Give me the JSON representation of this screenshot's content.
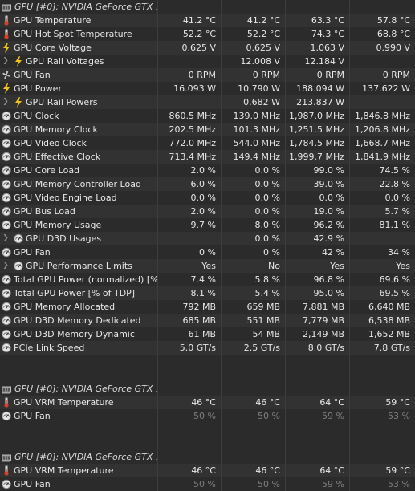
{
  "sections": [
    {
      "title": "GPU [#0]: NVIDIA GeForce GTX 1...",
      "rows": [
        {
          "icon": "thermometer-icon",
          "label": "GPU Temperature",
          "values": [
            "41.2 °C",
            "41.2 °C",
            "63.3 °C",
            "57.8 °C"
          ]
        },
        {
          "icon": "thermometer-icon",
          "label": "GPU Hot Spot Temperature",
          "values": [
            "52.2 °C",
            "52.2 °C",
            "74.3 °C",
            "68.8 °C"
          ]
        },
        {
          "icon": "lightning-icon",
          "label": "GPU Core Voltage",
          "values": [
            "0.625 V",
            "0.625 V",
            "1.063 V",
            "0.990 V"
          ]
        },
        {
          "icon": "lightning-icon",
          "label": "GPU Rail Voltages",
          "indent": true,
          "expander": true,
          "values": [
            "",
            "12.008 V",
            "12.184 V",
            ""
          ]
        },
        {
          "icon": "fan-icon",
          "label": "GPU Fan",
          "values": [
            "0 RPM",
            "0 RPM",
            "0 RPM",
            "0 RPM"
          ]
        },
        {
          "icon": "lightning-icon",
          "label": "GPU Power",
          "values": [
            "16.093 W",
            "10.790 W",
            "188.094 W",
            "137.622 W"
          ]
        },
        {
          "icon": "lightning-icon",
          "label": "GPU Rail Powers",
          "indent": true,
          "expander": true,
          "values": [
            "",
            "0.682 W",
            "213.837 W",
            ""
          ]
        },
        {
          "icon": "gauge-icon",
          "label": "GPU Clock",
          "values": [
            "860.5 MHz",
            "139.0 MHz",
            "1,987.0 MHz",
            "1,846.8 MHz"
          ]
        },
        {
          "icon": "gauge-icon",
          "label": "GPU Memory Clock",
          "values": [
            "202.5 MHz",
            "101.3 MHz",
            "1,251.5 MHz",
            "1,206.8 MHz"
          ]
        },
        {
          "icon": "gauge-icon",
          "label": "GPU Video Clock",
          "values": [
            "772.0 MHz",
            "544.0 MHz",
            "1,784.5 MHz",
            "1,668.7 MHz"
          ]
        },
        {
          "icon": "gauge-icon",
          "label": "GPU Effective Clock",
          "values": [
            "713.4 MHz",
            "149.4 MHz",
            "1,999.7 MHz",
            "1,841.9 MHz"
          ]
        },
        {
          "icon": "gauge-icon",
          "label": "GPU Core Load",
          "values": [
            "2.0 %",
            "0.0 %",
            "99.0 %",
            "74.5 %"
          ]
        },
        {
          "icon": "gauge-icon",
          "label": "GPU Memory Controller Load",
          "values": [
            "6.0 %",
            "0.0 %",
            "39.0 %",
            "22.8 %"
          ]
        },
        {
          "icon": "gauge-icon",
          "label": "GPU Video Engine Load",
          "values": [
            "0.0 %",
            "0.0 %",
            "0.0 %",
            "0.0 %"
          ]
        },
        {
          "icon": "gauge-icon",
          "label": "GPU Bus Load",
          "values": [
            "2.0 %",
            "0.0 %",
            "19.0 %",
            "5.7 %"
          ]
        },
        {
          "icon": "gauge-icon",
          "label": "GPU Memory Usage",
          "values": [
            "9.7 %",
            "8.0 %",
            "96.2 %",
            "81.1 %"
          ]
        },
        {
          "icon": "gauge-icon",
          "label": "GPU D3D Usages",
          "indent": true,
          "expander": true,
          "values": [
            "",
            "0.0 %",
            "42.9 %",
            ""
          ]
        },
        {
          "icon": "gauge-icon",
          "label": "GPU Fan",
          "values": [
            "0 %",
            "0 %",
            "42 %",
            "34 %"
          ]
        },
        {
          "icon": "gauge-icon",
          "label": "GPU Performance Limits",
          "indent": true,
          "expander": true,
          "values": [
            "",
            "Yes",
            "No",
            "Yes",
            "Yes"
          ]
        },
        {
          "icon": "gauge-icon",
          "label": "Total GPU Power (normalized) [% ...",
          "values": [
            "7.4 %",
            "5.8 %",
            "96.8 %",
            "69.6 %"
          ]
        },
        {
          "icon": "gauge-icon",
          "label": "Total GPU Power [% of TDP]",
          "values": [
            "8.1 %",
            "5.4 %",
            "95.0 %",
            "69.5 %"
          ]
        },
        {
          "icon": "gauge-icon",
          "label": "GPU Memory Allocated",
          "values": [
            "792 MB",
            "659 MB",
            "7,881 MB",
            "6,640 MB"
          ]
        },
        {
          "icon": "gauge-icon",
          "label": "GPU D3D Memory Dedicated",
          "values": [
            "685 MB",
            "551 MB",
            "7,779 MB",
            "6,538 MB"
          ]
        },
        {
          "icon": "gauge-icon",
          "label": "GPU D3D Memory Dynamic",
          "values": [
            "61 MB",
            "54 MB",
            "2,149 MB",
            "1,652 MB"
          ]
        },
        {
          "icon": "gauge-icon",
          "label": "PCIe Link Speed",
          "values": [
            "5.0 GT/s",
            "2.5 GT/s",
            "8.0 GT/s",
            "7.8 GT/s"
          ]
        }
      ]
    },
    {
      "title": "GPU [#0]: NVIDIA GeForce GTX 1...",
      "rows": [
        {
          "icon": "thermometer-icon",
          "label": "GPU VRM Temperature",
          "values": [
            "46 °C",
            "46 °C",
            "64 °C",
            "59 °C"
          ]
        },
        {
          "icon": "gauge-icon",
          "label": "GPU Fan",
          "dim": true,
          "values": [
            "50 %",
            "50 %",
            "59 %",
            "53 %"
          ]
        }
      ]
    },
    {
      "title": "GPU [#0]: NVIDIA GeForce GTX 1...",
      "rows": [
        {
          "icon": "thermometer-icon",
          "label": "GPU VRM Temperature",
          "values": [
            "46 °C",
            "46 °C",
            "64 °C",
            "59 °C"
          ]
        },
        {
          "icon": "gauge-icon",
          "label": "GPU Fan",
          "dim": true,
          "values": [
            "50 %",
            "50 %",
            "59 %",
            "53 %"
          ]
        }
      ]
    }
  ]
}
